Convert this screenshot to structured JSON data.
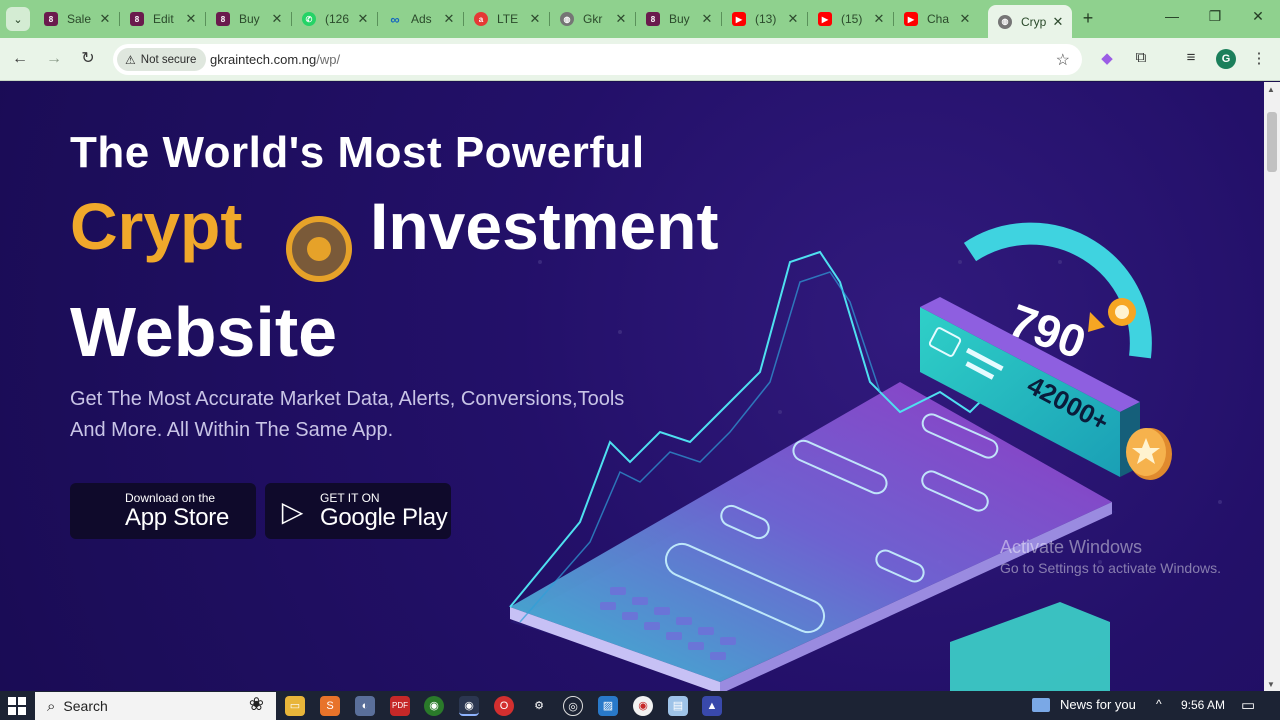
{
  "browser": {
    "tabs": [
      {
        "title": "Sale",
        "fav_color": "#6a1b4d"
      },
      {
        "title": "Edit",
        "fav_color": "#6a1b4d"
      },
      {
        "title": "Buy",
        "fav_color": "#6a1b4d"
      },
      {
        "title": "(126",
        "fav_color": "#25d366"
      },
      {
        "title": "Ads",
        "fav_color": "#1877f2"
      },
      {
        "title": "LTE",
        "fav_color": "#e53935"
      },
      {
        "title": "Gkr",
        "fav_color": "#757575"
      },
      {
        "title": "Buy",
        "fav_color": "#6a1b4d"
      },
      {
        "title": "(13)",
        "fav_color": "#ff0000"
      },
      {
        "title": "(15)",
        "fav_color": "#ff0000"
      },
      {
        "title": "Cha",
        "fav_color": "#ff0000"
      },
      {
        "title": "Cryp",
        "fav_color": "#757575",
        "active": true
      }
    ],
    "not_secure_label": "Not secure",
    "url_domain": "gkraintech.com.ng",
    "url_path": "/wp/",
    "profile_initial": "G"
  },
  "hero": {
    "line1": "The World's Most Powerful",
    "crypt": "Crypt",
    "investment": "Investment",
    "website": "Website",
    "subtitle_line1": "Get The Most Accurate Market Data, Alerts, Conversions,Tools",
    "subtitle_line2": "And More. All Within The Same App.",
    "appstore_small": "Download on the",
    "appstore_big": "App Store",
    "googleplay_small": "GET IT ON",
    "googleplay_big": "Google Play",
    "gauge_value": "790",
    "card_value": "42000+"
  },
  "watermark": {
    "line1": "Activate Windows",
    "line2": "Go to Settings to activate Windows."
  },
  "taskbar": {
    "search_placeholder": "Search",
    "news_label": "News for you",
    "time": "9:56 AM"
  },
  "colors": {
    "page_bg": "#1b1050",
    "accent_gold": "#f0a82b",
    "tabstrip": "#8fd18e",
    "teal": "#3fd3e0",
    "purple": "#8a3fd1"
  }
}
